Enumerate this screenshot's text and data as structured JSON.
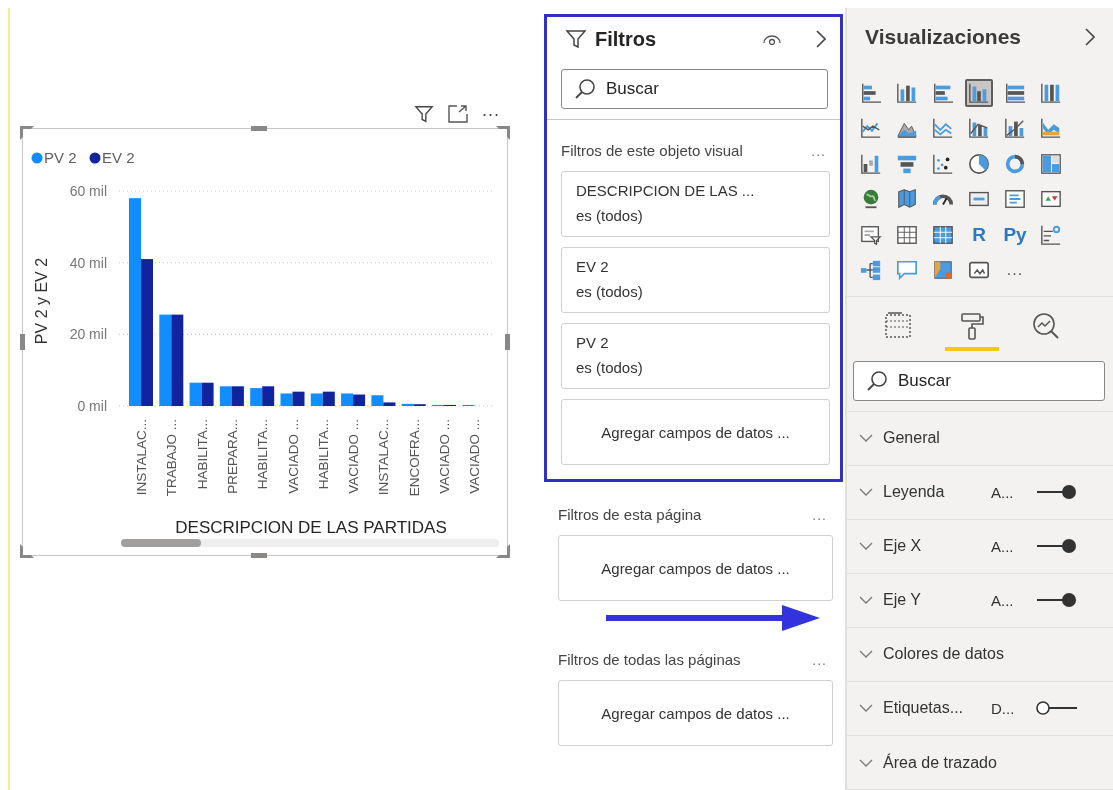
{
  "visual": {
    "header_menu": "...",
    "chart_data": {
      "type": "bar",
      "xlabel": "DESCRIPCION DE LAS PARTIDAS",
      "ylabel": "PV 2 y EV 2",
      "categories": [
        "INSTALAC...",
        "TRABAJO ...",
        "HABILITA...",
        "PREPARA...",
        "HABILITA...",
        "VACIADO ...",
        "HABILITA...",
        "VACIADO ...",
        "INSTALAC...",
        "ENCOFRA...",
        "VACIADO ...",
        "VACIADO ..."
      ],
      "series": [
        {
          "name": "PV 2",
          "color": "#118dff",
          "values": [
            58,
            25.5,
            6.5,
            5.5,
            5,
            3.5,
            3.5,
            3.5,
            3,
            0.6,
            0.3,
            0.3
          ]
        },
        {
          "name": "EV 2",
          "color": "#12239e",
          "values": [
            41,
            25.5,
            6.5,
            5.5,
            5.5,
            4,
            4,
            3.2,
            1,
            0.5,
            0.3,
            0
          ]
        }
      ],
      "legend": "top-left",
      "ylim": [
        0,
        60
      ],
      "yticks": [
        {
          "value": 0,
          "label": "0 mil"
        },
        {
          "value": 20,
          "label": "20 mil"
        },
        {
          "value": 40,
          "label": "40 mil"
        },
        {
          "value": 60,
          "label": "60 mil"
        }
      ]
    }
  },
  "filters": {
    "title": "Filtros",
    "search": {
      "placeholder": "Buscar"
    },
    "sections": [
      {
        "title": "Filtros de este objeto visual",
        "menu": "...",
        "cards": [
          {
            "title": "DESCRIPCION DE LAS ...",
            "subtitle": "es (todos)"
          },
          {
            "title": "EV 2",
            "subtitle": "es (todos)"
          },
          {
            "title": "PV 2",
            "subtitle": "es (todos)"
          }
        ],
        "add_label": "Agregar campos de datos ..."
      },
      {
        "title": "Filtros de esta página",
        "menu": "...",
        "add_label": "Agregar campos de datos ..."
      },
      {
        "title": "Filtros de todas las páginas",
        "menu": "...",
        "add_label": "Agregar campos de datos ..."
      }
    ]
  },
  "visualizations": {
    "title": "Visualizaciones",
    "items": [
      {
        "kind": "icon",
        "selected": false
      },
      {
        "kind": "icon",
        "selected": false
      },
      {
        "kind": "icon",
        "selected": false
      },
      {
        "kind": "icon",
        "selected": true
      },
      {
        "kind": "icon",
        "selected": false
      },
      {
        "kind": "icon",
        "selected": false
      },
      {
        "kind": "icon",
        "selected": false
      },
      {
        "kind": "icon",
        "selected": false
      },
      {
        "kind": "icon",
        "selected": false
      },
      {
        "kind": "icon",
        "selected": false
      },
      {
        "kind": "icon",
        "selected": false
      },
      {
        "kind": "icon",
        "selected": false
      },
      {
        "kind": "icon",
        "selected": false
      },
      {
        "kind": "icon",
        "selected": false
      },
      {
        "kind": "icon",
        "selected": false
      },
      {
        "kind": "icon",
        "selected": false
      },
      {
        "kind": "icon",
        "selected": false
      },
      {
        "kind": "icon",
        "selected": false
      },
      {
        "kind": "icon",
        "selected": false
      },
      {
        "kind": "icon",
        "selected": false
      },
      {
        "kind": "icon",
        "selected": false
      },
      {
        "kind": "icon",
        "selected": false
      },
      {
        "kind": "icon",
        "selected": false
      },
      {
        "kind": "icon",
        "selected": false
      },
      {
        "kind": "icon",
        "selected": false
      },
      {
        "kind": "icon",
        "selected": false
      },
      {
        "kind": "icon",
        "selected": false
      },
      {
        "kind": "text",
        "label": "R",
        "selected": false
      },
      {
        "kind": "text",
        "label": "Py",
        "selected": false
      },
      {
        "kind": "icon",
        "selected": false
      },
      {
        "kind": "icon",
        "selected": false
      },
      {
        "kind": "icon",
        "selected": false
      },
      {
        "kind": "icon",
        "selected": false
      },
      {
        "kind": "icon",
        "selected": false
      },
      {
        "kind": "more",
        "label": "...",
        "selected": false
      }
    ],
    "format_tabs": [
      {
        "selected": false
      },
      {
        "selected": true
      },
      {
        "selected": false
      }
    ],
    "search": {
      "placeholder": "Buscar"
    },
    "sections": [
      {
        "kind": "plain",
        "label": "General"
      },
      {
        "kind": "toggle",
        "label": "Leyenda",
        "value": "A...",
        "on": true
      },
      {
        "kind": "toggle",
        "label": "Eje X",
        "value": "A...",
        "on": true
      },
      {
        "kind": "toggle",
        "label": "Eje Y",
        "value": "A...",
        "on": true
      },
      {
        "kind": "plain",
        "label": "Colores de datos"
      },
      {
        "kind": "toggle",
        "label": "Etiquetas...",
        "value": "D...",
        "on": false
      },
      {
        "kind": "plain",
        "label": "Área de trazado"
      }
    ]
  }
}
